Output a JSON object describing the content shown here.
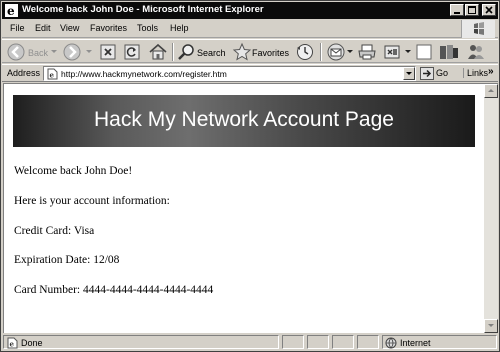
{
  "window": {
    "title": "Welcome back John Doe - Microsoft Internet Explorer"
  },
  "menu": {
    "items": [
      "File",
      "Edit",
      "View",
      "Favorites",
      "Tools",
      "Help"
    ]
  },
  "toolbar": {
    "back_label": "Back",
    "search_label": "Search",
    "favorites_label": "Favorites"
  },
  "address": {
    "label": "Address",
    "url": "http://www.hackmynetwork.com/register.htm",
    "go_label": "Go",
    "links_label": "Links",
    "links_chevron": "»"
  },
  "page": {
    "banner_title": "Hack My Network Account Page",
    "welcome": "Welcome back John Doe!",
    "intro": "Here is your account information:",
    "credit_card": "Credit Card: Visa",
    "expiration": "Expiration Date: 12/08",
    "card_number": "Card Number: 4444-4444-4444-4444-4444"
  },
  "status": {
    "text": "Done",
    "zone": "Internet"
  },
  "colors": {
    "titlebar": "#0a0a0a",
    "chrome": "#d4d0c8",
    "banner_dark": "#1a1a1a",
    "banner_light": "#6e6e6e"
  },
  "icons": [
    "ie-icon",
    "minimize-icon",
    "maximize-icon",
    "close-icon",
    "back-arrow-icon",
    "forward-arrow-icon",
    "stop-icon",
    "refresh-icon",
    "home-icon",
    "search-icon",
    "favorites-star-icon",
    "history-icon",
    "mail-icon",
    "print-icon",
    "edit-icon",
    "discuss-icon",
    "research-icon",
    "messenger-icon",
    "windows-logo-icon",
    "go-arrow-icon",
    "page-icon",
    "globe-icon"
  ]
}
